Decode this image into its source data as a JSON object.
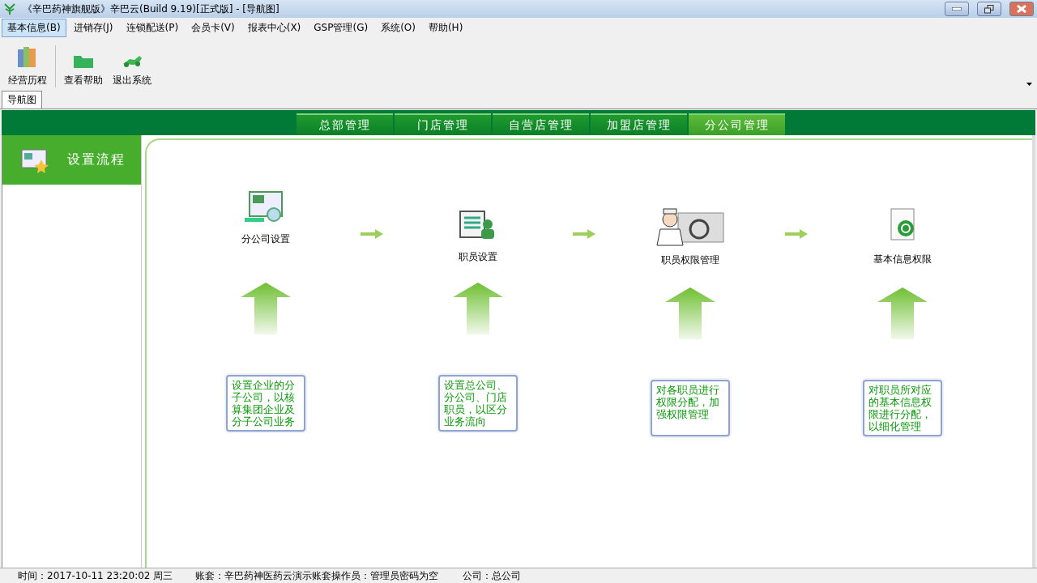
{
  "window": {
    "title": "《辛巴药神旗舰版》辛巴云(Build 9.19)[正式版] - [导航图]"
  },
  "menu": [
    {
      "label": "基本信息(B)",
      "selected": true
    },
    {
      "label": "进销存(J)",
      "selected": false
    },
    {
      "label": "连锁配送(P)",
      "selected": false
    },
    {
      "label": "会员卡(V)",
      "selected": false
    },
    {
      "label": "报表中心(X)",
      "selected": false
    },
    {
      "label": "GSP管理(G)",
      "selected": false
    },
    {
      "label": "系统(O)",
      "selected": false
    },
    {
      "label": "帮助(H)",
      "selected": false
    }
  ],
  "toolbar": [
    {
      "label": "经营历程",
      "kind": "books"
    },
    {
      "label": "查看帮助",
      "kind": "folder"
    },
    {
      "label": "退出系统",
      "kind": "exit"
    }
  ],
  "doc_tab": {
    "label": "导航图"
  },
  "section_tabs": [
    {
      "label": "总部管理",
      "selected": false
    },
    {
      "label": "门店管理",
      "selected": false
    },
    {
      "label": "自营店管理",
      "selected": false
    },
    {
      "label": "加盟店管理",
      "selected": false
    },
    {
      "label": "分公司管理",
      "selected": true
    }
  ],
  "sidebar": {
    "items": [
      {
        "label": "设置流程",
        "selected": true
      }
    ]
  },
  "steps": [
    {
      "label": "分公司设置",
      "kind": "company",
      "description": "设置企业的分子公司，以核算集团企业及分子公司业务"
    },
    {
      "label": "职员设置",
      "kind": "staff",
      "description": "设置总公司、分公司、门店职员，以区分业务流向"
    },
    {
      "label": "职员权限管理",
      "kind": "doctor",
      "description": "对各职员进行权限分配，加强权限管理"
    },
    {
      "label": "基本信息权限",
      "kind": "mail",
      "description": "对职员所对应的基本信息权限进行分配，以细化管理"
    }
  ],
  "status_bar": [
    "时间：2017-10-11 23:20:02 周三",
    "账套：辛巴药神医药云演示账套",
    "操作员：管理员密码为空",
    "公司：总公司"
  ]
}
